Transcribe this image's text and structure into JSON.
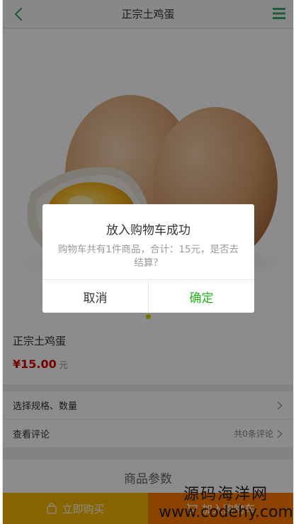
{
  "header": {
    "title": "正宗土鸡蛋",
    "back_icon": "chevron-left-icon",
    "menu_icon": "menu-icon",
    "accent": "#3aaa6a"
  },
  "hero": {
    "carousel_active_index": 1,
    "carousel_count": 1
  },
  "product": {
    "name": "正宗土鸡蛋",
    "price": "¥15.00",
    "unit": "元",
    "price_color": "#d60000"
  },
  "rows": [
    {
      "label": "选择规格、数量",
      "meta": ""
    },
    {
      "label": "查看评论",
      "meta": "共0条评论"
    }
  ],
  "params": {
    "label": "商品参数"
  },
  "bottom_bar": {
    "buy_now_label": "立即购买",
    "add_cart_label": "加入购物车",
    "buy_now_color": "#f7b600",
    "add_cart_color": "#ff7a00"
  },
  "dialog": {
    "title": "放入购物车成功",
    "message": "购物车共有1件商品，合计：15元，是否去结算？",
    "cancel_label": "取消",
    "ok_label": "确定",
    "ok_color": "#24b21e"
  },
  "watermark": {
    "line1": "源码海洋网",
    "line2": "www.codehy.com"
  }
}
